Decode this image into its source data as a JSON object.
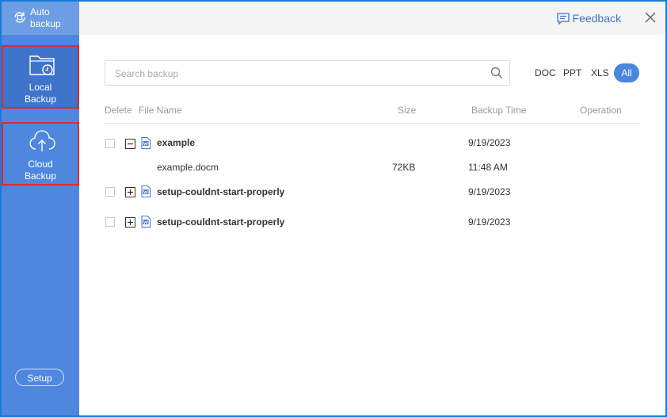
{
  "sidebar": {
    "auto_backup_label_1": "Auto",
    "auto_backup_label_2": "backup",
    "local_backup_label_1": "Local",
    "local_backup_label_2": "Backup",
    "cloud_backup_label_1": "Cloud",
    "cloud_backup_label_2": "Backup",
    "setup_label": "Setup"
  },
  "header": {
    "feedback_label": "Feedback"
  },
  "search": {
    "placeholder": "Search backup",
    "value": ""
  },
  "filters": {
    "doc": "DOC",
    "ppt": "PPT",
    "xls": "XLS",
    "all": "All",
    "selected": "All"
  },
  "table": {
    "columns": {
      "delete": "Delete",
      "file_name": "File Name",
      "size": "Size",
      "backup_time": "Backup Time",
      "operation": "Operation"
    },
    "rows": [
      {
        "name": "example",
        "size": "",
        "time": "9/19/2023",
        "expanded": true
      },
      {
        "name": "example.docm",
        "size": "72KB",
        "time": "11:48 AM",
        "child": true
      },
      {
        "name": "setup-couldnt-start-properly",
        "size": "",
        "time": "9/19/2023",
        "expanded": false
      },
      {
        "name": "setup-couldnt-start-properly",
        "size": "",
        "time": "9/19/2023",
        "expanded": false
      }
    ]
  },
  "colors": {
    "accent": "#4a85de",
    "sidebar": "#4e87dd",
    "highlight_border": "#e8262a"
  },
  "icons": {
    "auto_backup": "auto-backup-icon",
    "local_backup": "folder-clock-icon",
    "cloud_backup": "cloud-upload-icon",
    "feedback": "feedback-icon",
    "close": "close-icon",
    "search": "search-icon",
    "word_file": "word-doc-icon"
  }
}
